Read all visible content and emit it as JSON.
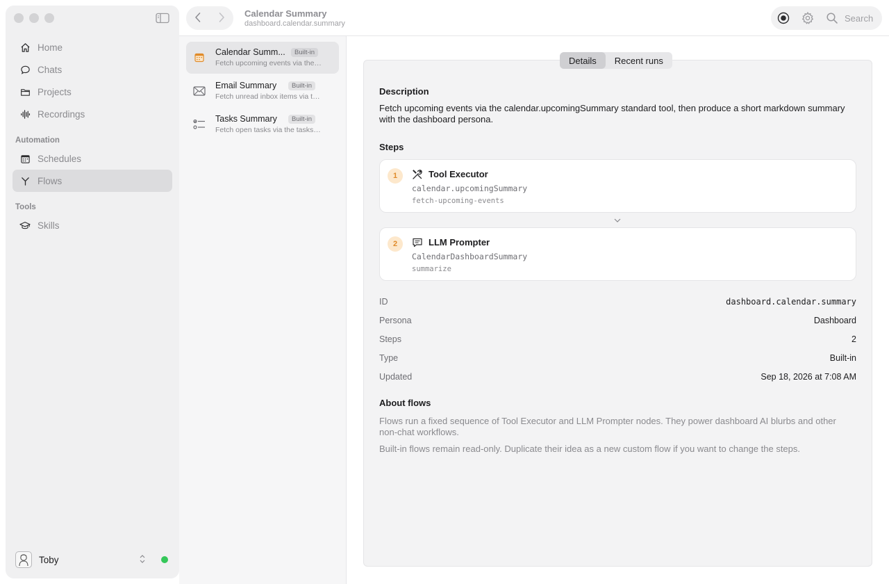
{
  "sidebar": {
    "nav": [
      {
        "label": "Home",
        "icon": "home-icon"
      },
      {
        "label": "Chats",
        "icon": "chat-bubble-icon"
      },
      {
        "label": "Projects",
        "icon": "folder-icon"
      },
      {
        "label": "Recordings",
        "icon": "waveform-icon"
      }
    ],
    "automation_label": "Automation",
    "automation": [
      {
        "label": "Schedules",
        "icon": "calendar-icon"
      },
      {
        "label": "Flows",
        "icon": "flow-icon",
        "active": true
      }
    ],
    "tools_label": "Tools",
    "tools": [
      {
        "label": "Skills",
        "icon": "graduation-cap-icon"
      }
    ],
    "user": {
      "name": "Toby",
      "status_color": "#34c759"
    }
  },
  "topbar": {
    "title": "Calendar Summary",
    "subtitle": "dashboard.calendar.summary",
    "search_label": "Search"
  },
  "flows": [
    {
      "name": "Calendar Summ...",
      "badge": "Built-in",
      "desc": "Fetch upcoming events via the…",
      "icon": "calendar-icon",
      "active": true
    },
    {
      "name": "Email Summary",
      "badge": "Built-in",
      "desc": "Fetch unread inbox items via t…",
      "icon": "envelope-icon"
    },
    {
      "name": "Tasks Summary",
      "badge": "Built-in",
      "desc": "Fetch open tasks via the tasks…",
      "icon": "checklist-icon"
    }
  ],
  "detail": {
    "tabs": [
      {
        "label": "Details",
        "active": true
      },
      {
        "label": "Recent runs"
      }
    ],
    "description_heading": "Description",
    "description": "Fetch upcoming events via the calendar.upcomingSummary standard tool, then produce a short markdown summary with the dashboard persona.",
    "steps_heading": "Steps",
    "steps": [
      {
        "num": "1",
        "title": "Tool Executor",
        "code": "calendar.upcomingSummary",
        "id": "fetch-upcoming-events",
        "icon": "tools-icon"
      },
      {
        "num": "2",
        "title": "LLM Prompter",
        "code": "CalendarDashboardSummary",
        "id": "summarize",
        "icon": "message-icon"
      }
    ],
    "meta": [
      {
        "key": "ID",
        "value": "dashboard.calendar.summary"
      },
      {
        "key": "Persona",
        "value": "Dashboard"
      },
      {
        "key": "Steps",
        "value": "2"
      },
      {
        "key": "Type",
        "value": "Built-in"
      },
      {
        "key": "Updated",
        "value": "Sep 18, 2026 at 7:08 AM"
      }
    ],
    "about_heading": "About flows",
    "about_p1": "Flows run a fixed sequence of Tool Executor and LLM Prompter nodes. They power dashboard AI blurbs and other non-chat workflows.",
    "about_p2": "Built-in flows remain read-only. Duplicate their idea as a new custom flow if you want to change the steps."
  },
  "colors": {
    "accent_orange": "#e08b2a",
    "step_badge_bg": "#fde8cc",
    "online": "#34c759"
  }
}
